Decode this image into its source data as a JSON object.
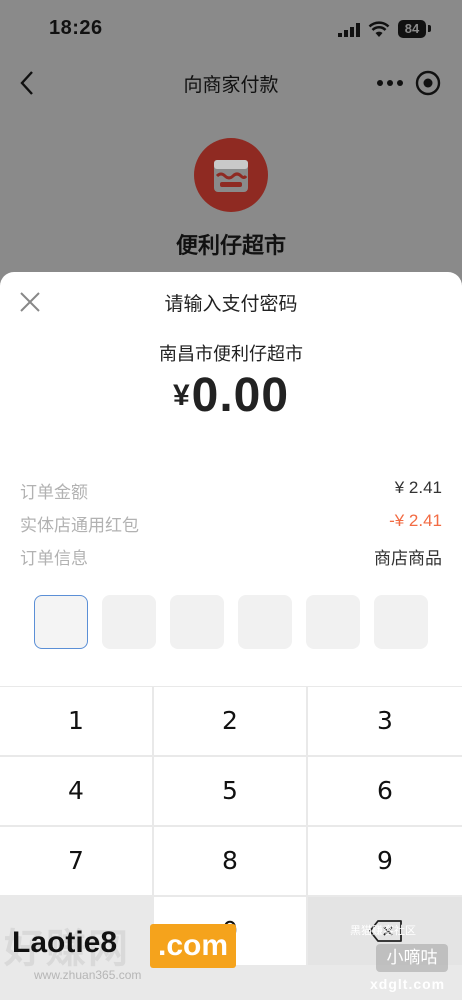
{
  "status_bar": {
    "time": "18:26",
    "battery": "84"
  },
  "nav": {
    "title": "向商家付款"
  },
  "merchant": {
    "name": "便利仔超市",
    "logo_color": "#8f2a22"
  },
  "sheet": {
    "title": "请输入支付密码",
    "payee": "南昌市便利仔超市",
    "amount_currency": "¥",
    "amount_value": "0.00",
    "details": [
      {
        "label": "订单金额",
        "value": "¥ 2.41"
      },
      {
        "label": "实体店通用红包",
        "value": "-¥ 2.41"
      },
      {
        "label": "订单信息",
        "value": "商店商品"
      }
    ],
    "pin_length": 6,
    "pin_filled": 0,
    "accent_color": "#f26b43"
  },
  "keypad": {
    "keys": [
      "1",
      "2",
      "3",
      "4",
      "5",
      "6",
      "7",
      "8",
      "9",
      "",
      "0",
      ""
    ]
  },
  "watermarks": {
    "left_ghost": "好赚网",
    "left_brand": "Laotie8",
    "left_com": ".com",
    "left_sub": "www.zhuan365.com",
    "right_top": "黑猫赚客社区",
    "right_box": "小嘀咕",
    "right_url": "xdglt.com"
  }
}
